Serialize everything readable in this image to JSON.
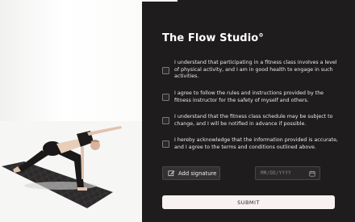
{
  "studio": {
    "title": "The Flow Studio°"
  },
  "agreements": [
    {
      "checked": false,
      "text": "I understand that participating in a fitness class involves a level of physical activity, and I am in good health to engage in such activities."
    },
    {
      "checked": false,
      "text": "I agree to follow the rules and instructions provided by the fitness instructor for the safety of myself and others."
    },
    {
      "checked": false,
      "text": "I understand that the fitness class schedule may be subject to change, and I will be notified in advance if possible."
    },
    {
      "checked": false,
      "text": "I hereby acknowledge that the information provided is accurate, and I agree to the terms and conditions outlined above."
    }
  ],
  "signature": {
    "button_label": "Add signature",
    "icon": "edit-signature-icon"
  },
  "date": {
    "placeholder": "MM/DD/YYYY",
    "icon": "calendar-icon"
  },
  "submit": {
    "label": "SUBMIT"
  },
  "colors": {
    "panel_background": "#1f1c1d",
    "submit_background": "#f7f1f2",
    "yoga_mat": "#2c2a2b"
  }
}
